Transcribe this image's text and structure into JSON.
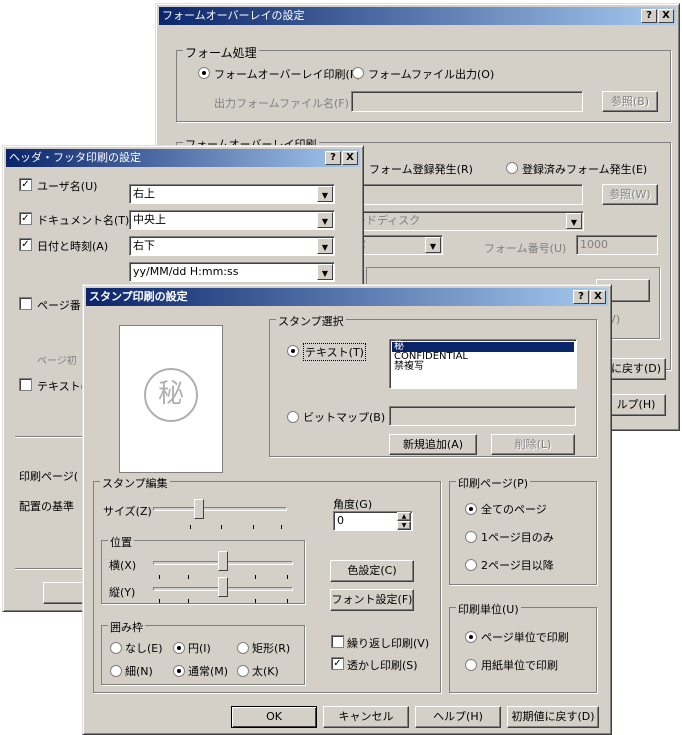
{
  "win1": {
    "title": "フォームオーバーレイの設定",
    "group_process": "フォーム処理",
    "radio_overlay_print": "フォームオーバーレイ印刷(P)",
    "radio_form_file_output": "フォームファイル出力(O)",
    "output_file_label": "出力フォームファイル名(F)",
    "browse1": "参照(B)",
    "group_overlay_print": "フォームオーバーレイ印刷",
    "radio_form_register": "フォーム登録発生(R)",
    "radio_registered_form": "登録済みフォーム発生(E)",
    "browse2": "参照(W)",
    "combo_device": "ードディスク",
    "combo_normal": "常",
    "form_number_label": "フォーム番号(U)",
    "form_number_value": "1000",
    "partial_v": "(V)",
    "reset_partial": "に戻す(D)",
    "help_partial": "ルプ(H)"
  },
  "win2": {
    "title": "ヘッダ・フッタ印刷の設定",
    "chk_user": "ユーザ名(U)",
    "chk_doc": "ドキュメント名(T)",
    "chk_date": "日付と時刻(A)",
    "combo_user": "右上",
    "combo_doc": "中央上",
    "combo_date": "右下",
    "combo_format": "yy/MM/dd  H:mm:ss",
    "chk_page": "ページ番",
    "page_init": "ページ初",
    "chk_text": "テキスト(X",
    "print_page": "印刷ページ(",
    "placement": "配置の基準"
  },
  "win3": {
    "title": "スタンプ印刷の設定",
    "preview_char": "秘",
    "group_select": "スタンプ選択",
    "radio_text": "テキスト(T)",
    "radio_bitmap": "ビットマップ(B)",
    "list_items": [
      "秘",
      "CONFIDENTIAL",
      "禁複写"
    ],
    "btn_new": "新規追加(A)",
    "btn_delete": "削除(L)",
    "group_edit": "スタンプ編集",
    "size_label": "サイズ(Z)",
    "angle_label": "角度(G)",
    "angle_value": "0",
    "group_pos": "位置",
    "horiz_label": "横(X)",
    "vert_label": "縦(Y)",
    "btn_color": "色設定(C)",
    "btn_font": "フォント設定(F)",
    "group_frame": "囲み枠",
    "frame_none": "なし(E)",
    "frame_circle": "円(I)",
    "frame_rect": "矩形(R)",
    "frame_thin": "細(N)",
    "frame_normal": "通常(M)",
    "frame_thick": "太(K)",
    "chk_repeat": "繰り返し印刷(V)",
    "chk_transparent": "透かし印刷(S)",
    "group_pages": "印刷ページ(P)",
    "radio_all": "全てのページ",
    "radio_first": "1ページ目のみ",
    "radio_second": "2ページ目以降",
    "group_unit": "印刷単位(U)",
    "radio_page_unit": "ページ単位で印刷",
    "radio_paper_unit": "用紙単位で印刷",
    "btn_ok": "OK",
    "btn_cancel": "キャンセル",
    "btn_help": "ヘルプ(H)",
    "btn_reset": "初期値に戻す(D)",
    "check_mark": "✓",
    "help_q": "?",
    "close_x": "X"
  },
  "controls": {
    "size_slider": 0.33,
    "horizontal_slider": 0.5,
    "vertical_slider": 0.5
  }
}
